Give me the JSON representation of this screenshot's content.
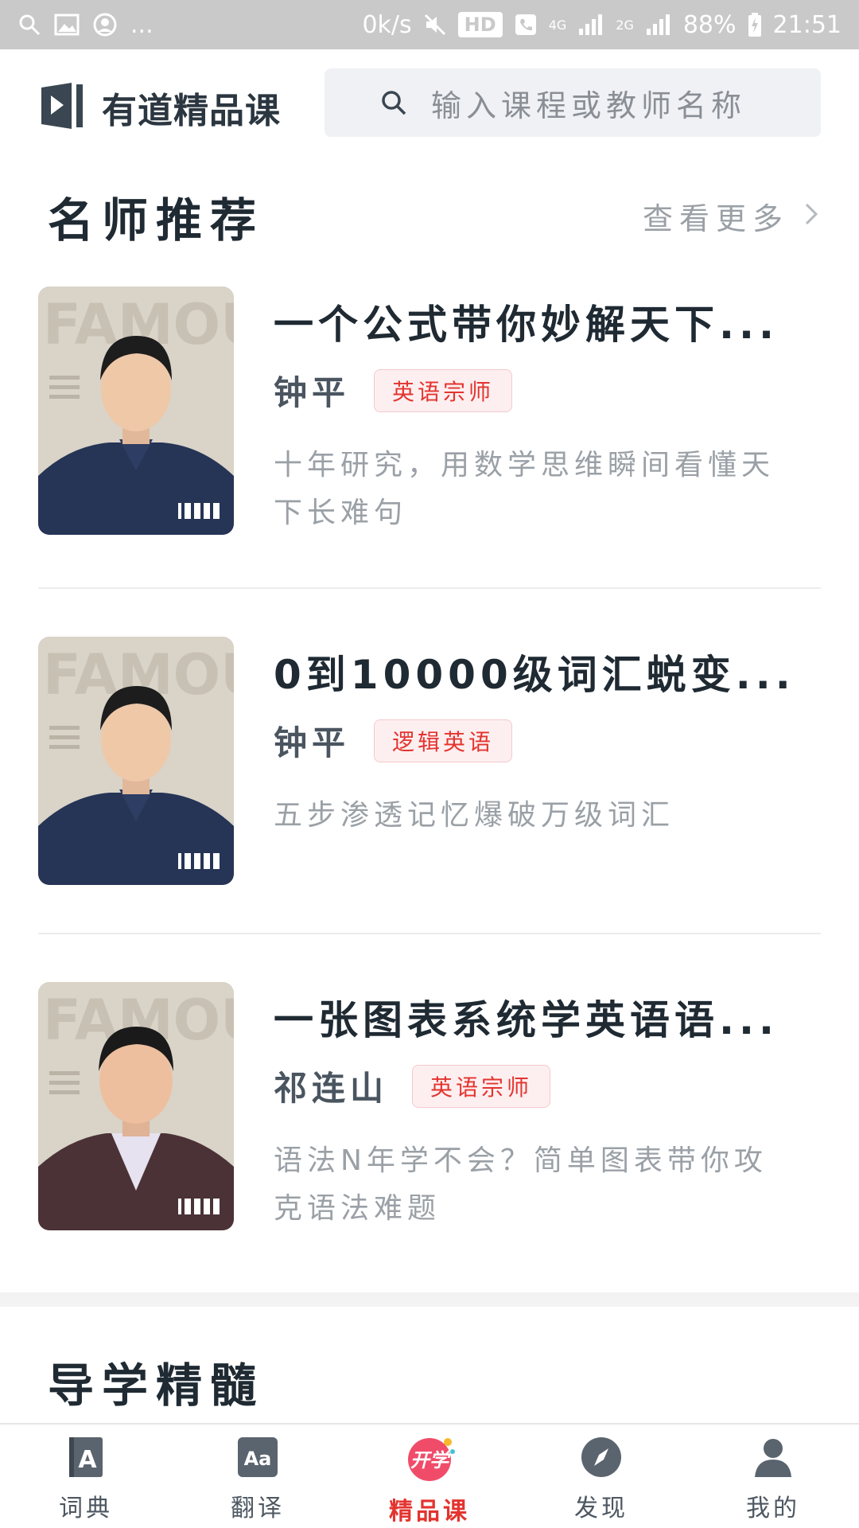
{
  "status_bar": {
    "speed": "0k/s",
    "hd": "HD",
    "network": "4G",
    "network2": "2G",
    "battery": "88%",
    "time": "21:51",
    "ellipsis": "..."
  },
  "header": {
    "app_title": "有道精品课",
    "search_placeholder": "输入课程或教师名称"
  },
  "section": {
    "title": "名师推荐",
    "more_label": "查看更多"
  },
  "courses": [
    {
      "title": "一个公式带你妙解天下...",
      "teacher": "钟平",
      "tag": "英语宗师",
      "desc_line1": "十年研究，用数学思维瞬间看懂天",
      "desc_line2": "下长难句"
    },
    {
      "title": "0到10000级词汇蜕变...",
      "teacher": "钟平",
      "tag": "逻辑英语",
      "desc_line1": "五步渗透记忆爆破万级词汇",
      "desc_line2": ""
    },
    {
      "title": "一张图表系统学英语语...",
      "teacher": "祁连山",
      "tag": "英语宗师",
      "desc_line1": "语法N年学不会？简单图表带你攻",
      "desc_line2": "克语法难题"
    }
  ],
  "thumb_text": "FAMOUS",
  "section2": {
    "title": "导学精髓"
  },
  "bottom_nav": {
    "items": [
      {
        "label": "词典",
        "icon": "dictionary-icon"
      },
      {
        "label": "翻译",
        "icon": "translate-icon"
      },
      {
        "label": "精品课",
        "icon": "kaixue-icon",
        "badge": "开学"
      },
      {
        "label": "发现",
        "icon": "compass-icon"
      },
      {
        "label": "我的",
        "icon": "user-icon"
      }
    ],
    "active_index": 2
  },
  "colors": {
    "accent": "#e3342f",
    "title": "#1f2a33",
    "muted": "#9aa0a6"
  }
}
